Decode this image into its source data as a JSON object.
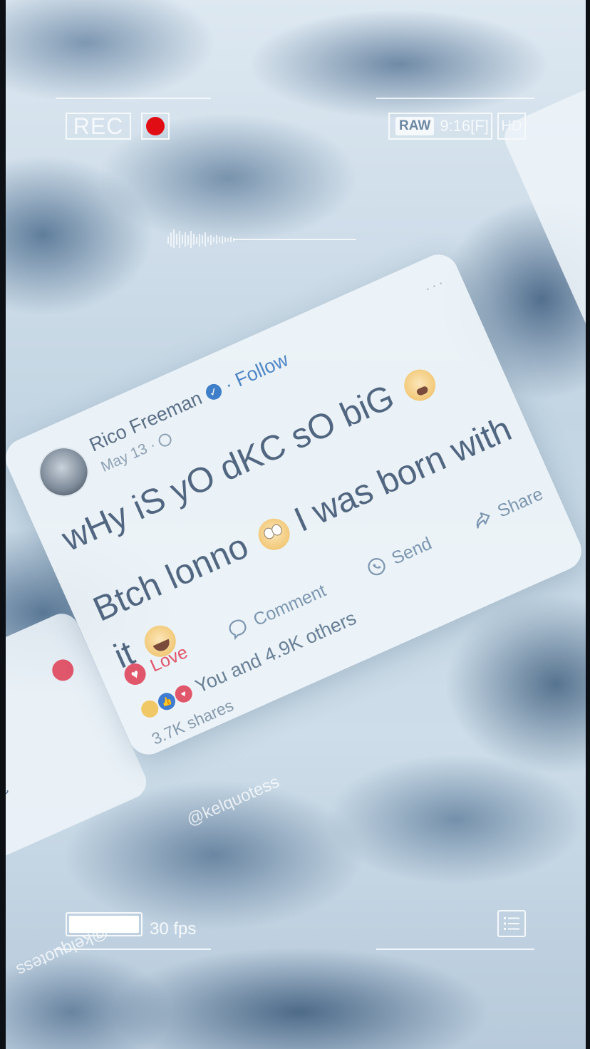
{
  "hud": {
    "rec_label": "REC",
    "raw_badge": "RAW",
    "resolution": "9:16[F]",
    "hd_label": "HD",
    "fps_label": "30 fps",
    "colors": {
      "rec_dot": "#e10d14",
      "hud": "#f6f9fb"
    }
  },
  "post": {
    "author": "Rico Freeman",
    "follow": "· Follow",
    "date": "May 13 ·",
    "text_line1": "wHy iS yO dKC sO biG",
    "text_line2": "Btch lonno",
    "text_line3": "I was born with",
    "text_line4": "it",
    "emoji_1": "weary-face",
    "emoji_2": "face-with-rolling-eyes",
    "emoji_3": "face-with-tears-of-joy",
    "actions": {
      "love": "Love",
      "comment": "Comment",
      "send": "Send",
      "share": "Share"
    },
    "reactions_text": "You and 4.9K others",
    "shares": "3.7K shares",
    "colors": {
      "love": "#e0566b",
      "verified": "#3f7ec9",
      "follow": "#4f86c6"
    }
  },
  "left_card": {
    "shares": "3.7K shares"
  },
  "watermark": {
    "handle": "@kelquotess"
  }
}
